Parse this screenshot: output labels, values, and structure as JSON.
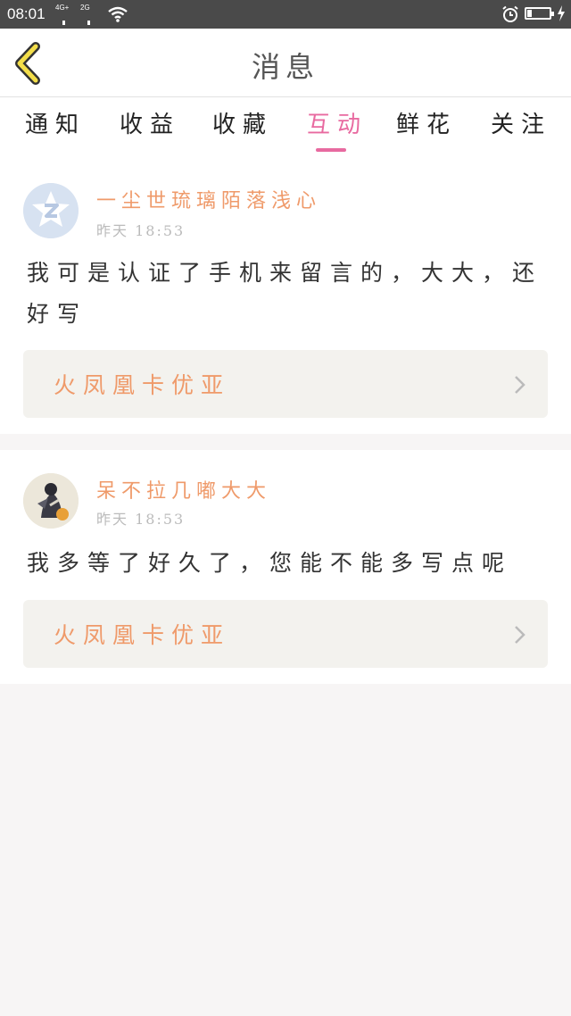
{
  "status_bar": {
    "time": "08:01",
    "signal1_label": "4G+",
    "signal2_label": "2G"
  },
  "header": {
    "title": "消息"
  },
  "tabs": [
    {
      "label": "通知"
    },
    {
      "label": "收益"
    },
    {
      "label": "收藏"
    },
    {
      "label": "互动"
    },
    {
      "label": "鲜花"
    },
    {
      "label": "关注"
    }
  ],
  "active_tab": "互动",
  "messages": [
    {
      "username": "一尘世琉璃陌落浅心",
      "time": "昨天 18:53",
      "comment": "我可是认证了手机来留言的，大大，还好写",
      "book_title": "火凤凰卡优亚",
      "avatar": "qq-default-avatar-icon"
    },
    {
      "username": "呆不拉几嘟大大",
      "time": "昨天 18:53",
      "comment": "我多等了好久了，您能不能多写点呢",
      "book_title": "火凤凰卡优亚",
      "avatar": "user-photo-avatar"
    }
  ],
  "colors": {
    "accent": "#e86aa0",
    "username": "#ef9a6a",
    "status_bar": "#4a4a4a"
  }
}
